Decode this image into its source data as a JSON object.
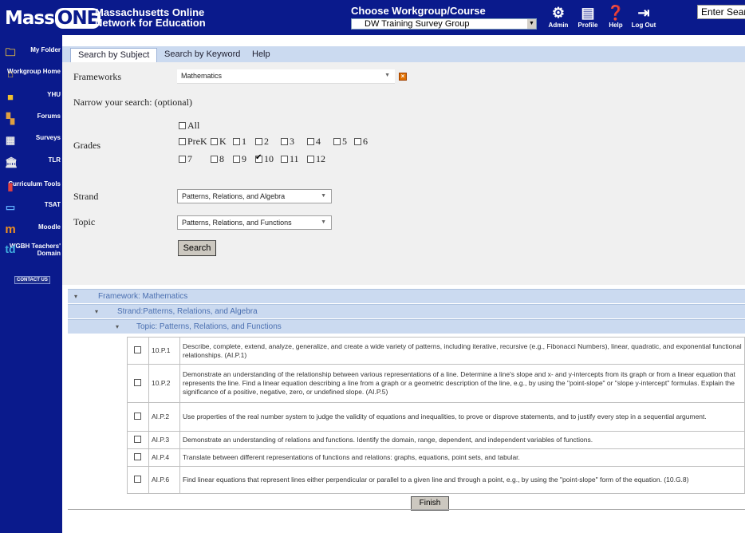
{
  "header": {
    "logo_left": "Mass",
    "logo_one": "ONE",
    "network_line1": "Massachusetts Online",
    "network_line2": "Network for Education",
    "choose_label": "Choose Workgroup/Course",
    "workgroup_value": "DW Training Survey Group",
    "search_placeholder": "Enter Sear",
    "icons": [
      {
        "label": "Admin",
        "icon": "gears-icon"
      },
      {
        "label": "Profile",
        "icon": "document-icon"
      },
      {
        "label": "Help",
        "icon": "question-icon"
      },
      {
        "label": "Log Out",
        "icon": "logout-icon"
      }
    ]
  },
  "sidebar": {
    "items": [
      {
        "label": "My Folder",
        "icon": "folder-lock-icon"
      },
      {
        "label": "Workgroup Home",
        "icon": "house-icon"
      },
      {
        "label": "YHU",
        "icon": "folder-icon"
      },
      {
        "label": "Forums",
        "icon": "forum-icon"
      },
      {
        "label": "Surveys",
        "icon": "survey-icon"
      },
      {
        "label": "TLR",
        "icon": "building-icon"
      },
      {
        "label": "Curriculum Tools",
        "icon": "tools-icon"
      },
      {
        "label": "TSAT",
        "icon": "monitor-icon"
      },
      {
        "label": "Moodle",
        "icon": "moodle-icon"
      },
      {
        "label": "WGBH Teachers' Domain",
        "icon": "td-icon"
      }
    ],
    "contact": "CONTACT US"
  },
  "tabs": [
    "Search by Subject",
    "Search by Keyword",
    "Help"
  ],
  "form": {
    "frameworks_label": "Frameworks",
    "frameworks_value": "Mathematics",
    "narrow_label": "Narrow your search: (optional)",
    "grades_label": "Grades",
    "grades": {
      "all": "All",
      "row1": [
        "PreK",
        "K",
        "1",
        "2",
        "3",
        "4",
        "5",
        "6"
      ],
      "row2": [
        "7",
        "8",
        "9",
        "10",
        "11",
        "12"
      ],
      "checked": "10"
    },
    "strand_label": "Strand",
    "strand_value": "Patterns, Relations, and Algebra",
    "topic_label": "Topic",
    "topic_value": "Patterns, Relations, and Functions",
    "search_button": "Search"
  },
  "results": {
    "framework_header": "Framework: Mathematics",
    "strand_header": "Strand:Patterns, Relations, and Algebra",
    "topic_header": "Topic: Patterns, Relations, and Functions",
    "rows": [
      {
        "code": "10.P.1",
        "text": "Describe, complete, extend, analyze, generalize, and create a wide variety of patterns, including iterative, recursive (e.g., Fibonacci Numbers), linear, quadratic, and exponential functional relationships. (AI.P.1)"
      },
      {
        "code": "10.P.2",
        "text": "Demonstrate an understanding of the relationship between various representations of a line. Determine a line's slope and x- and y-intercepts from its graph or from a linear equation that represents the line. Find a linear equation describing a line from a graph or a geometric description of the line, e.g., by using the \"point-slope\" or \"slope y-intercept\" formulas. Explain the significance of a positive, negative, zero, or undefined slope. (AI.P.5)"
      },
      {
        "code": "AI.P.2",
        "text": "Use properties of the real number system to judge the validity of equations and inequalities, to prove or disprove statements, and to justify every step in a sequential argument."
      },
      {
        "code": "AI.P.3",
        "text": "Demonstrate an understanding of relations and functions. Identify the domain, range, dependent, and independent variables of functions."
      },
      {
        "code": "AI.P.4",
        "text": "Translate between different representations of functions and relations: graphs, equations, point sets, and tabular."
      },
      {
        "code": "AI.P.6",
        "text": "Find linear equations that represent lines either perpendicular or parallel to a given line and through a point, e.g., by using the \"point-slope\" form of the equation. (10.G.8)"
      }
    ],
    "finish_button": "Finish"
  }
}
